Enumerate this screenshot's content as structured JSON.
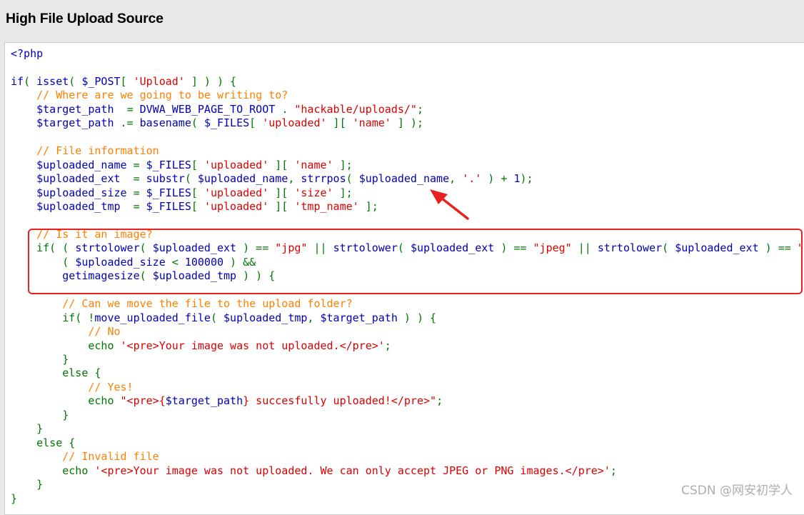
{
  "header": {
    "title": "High File Upload Source"
  },
  "colors": {
    "keyword": "#007700",
    "string": "#dd0000",
    "comment": "#ff8000",
    "default": "#0000bb",
    "annotation": "#e8231f"
  },
  "code_lines": [
    [
      [
        "def",
        "<?php"
      ]
    ],
    [],
    [
      [
        "def",
        "if"
      ],
      [
        "kw",
        "( "
      ],
      [
        "def",
        "isset"
      ],
      [
        "kw",
        "( "
      ],
      [
        "def",
        "$_POST"
      ],
      [
        "kw",
        "[ "
      ],
      [
        "str",
        "'Upload'"
      ],
      [
        "kw",
        " ] ) ) {"
      ]
    ],
    [
      [
        "cm",
        "    // Where are we going to be writing to?"
      ]
    ],
    [
      [
        "def",
        "    $target_path  "
      ],
      [
        "kw",
        "= "
      ],
      [
        "def",
        "DVWA_WEB_PAGE_TO_ROOT "
      ],
      [
        "kw",
        ". "
      ],
      [
        "str",
        "\"hackable/uploads/\""
      ],
      [
        "kw",
        ";"
      ]
    ],
    [
      [
        "def",
        "    $target_path "
      ],
      [
        "kw",
        ".= "
      ],
      [
        "def",
        "basename"
      ],
      [
        "kw",
        "( "
      ],
      [
        "def",
        "$_FILES"
      ],
      [
        "kw",
        "[ "
      ],
      [
        "str",
        "'uploaded'"
      ],
      [
        "kw",
        " ][ "
      ],
      [
        "str",
        "'name'"
      ],
      [
        "kw",
        " ] );"
      ]
    ],
    [],
    [
      [
        "cm",
        "    // File information"
      ]
    ],
    [
      [
        "def",
        "    $uploaded_name "
      ],
      [
        "kw",
        "= "
      ],
      [
        "def",
        "$_FILES"
      ],
      [
        "kw",
        "[ "
      ],
      [
        "str",
        "'uploaded'"
      ],
      [
        "kw",
        " ][ "
      ],
      [
        "str",
        "'name'"
      ],
      [
        "kw",
        " ];"
      ]
    ],
    [
      [
        "def",
        "    $uploaded_ext  "
      ],
      [
        "kw",
        "= "
      ],
      [
        "def",
        "substr"
      ],
      [
        "kw",
        "( "
      ],
      [
        "def",
        "$uploaded_name"
      ],
      [
        "kw",
        ", "
      ],
      [
        "def",
        "strrpos"
      ],
      [
        "kw",
        "( "
      ],
      [
        "def",
        "$uploaded_name"
      ],
      [
        "kw",
        ", "
      ],
      [
        "str",
        "'.'"
      ],
      [
        "kw",
        " ) + "
      ],
      [
        "def",
        "1"
      ],
      [
        "kw",
        ");"
      ]
    ],
    [
      [
        "def",
        "    $uploaded_size "
      ],
      [
        "kw",
        "= "
      ],
      [
        "def",
        "$_FILES"
      ],
      [
        "kw",
        "[ "
      ],
      [
        "str",
        "'uploaded'"
      ],
      [
        "kw",
        " ][ "
      ],
      [
        "str",
        "'size'"
      ],
      [
        "kw",
        " ];"
      ]
    ],
    [
      [
        "def",
        "    $uploaded_tmp  "
      ],
      [
        "kw",
        "= "
      ],
      [
        "def",
        "$_FILES"
      ],
      [
        "kw",
        "[ "
      ],
      [
        "str",
        "'uploaded'"
      ],
      [
        "kw",
        " ][ "
      ],
      [
        "str",
        "'tmp_name'"
      ],
      [
        "kw",
        " ];"
      ]
    ],
    [],
    [
      [
        "cm",
        "    // Is it an image?"
      ]
    ],
    [
      [
        "kw",
        "    if( ( "
      ],
      [
        "def",
        "strtolower"
      ],
      [
        "kw",
        "( "
      ],
      [
        "def",
        "$uploaded_ext"
      ],
      [
        "kw",
        " ) == "
      ],
      [
        "str",
        "\"jpg\""
      ],
      [
        "kw",
        " || "
      ],
      [
        "def",
        "strtolower"
      ],
      [
        "kw",
        "( "
      ],
      [
        "def",
        "$uploaded_ext"
      ],
      [
        "kw",
        " ) == "
      ],
      [
        "str",
        "\"jpeg\""
      ],
      [
        "kw",
        " || "
      ],
      [
        "def",
        "strtolower"
      ],
      [
        "kw",
        "( "
      ],
      [
        "def",
        "$uploaded_ext"
      ],
      [
        "kw",
        " ) == "
      ],
      [
        "str",
        "\"pn"
      ]
    ],
    [
      [
        "kw",
        "        ( "
      ],
      [
        "def",
        "$uploaded_size"
      ],
      [
        "kw",
        " < "
      ],
      [
        "def",
        "100000"
      ],
      [
        "kw",
        " ) &&"
      ]
    ],
    [
      [
        "def",
        "        getimagesize"
      ],
      [
        "kw",
        "( "
      ],
      [
        "def",
        "$uploaded_tmp"
      ],
      [
        "kw",
        " ) ) {"
      ]
    ],
    [],
    [
      [
        "cm",
        "        // Can we move the file to the upload folder?"
      ]
    ],
    [
      [
        "kw",
        "        if( !"
      ],
      [
        "def",
        "move_uploaded_file"
      ],
      [
        "kw",
        "( "
      ],
      [
        "def",
        "$uploaded_tmp"
      ],
      [
        "kw",
        ", "
      ],
      [
        "def",
        "$target_path"
      ],
      [
        "kw",
        " ) ) {"
      ]
    ],
    [
      [
        "cm",
        "            // No"
      ]
    ],
    [
      [
        "kw",
        "            echo "
      ],
      [
        "str",
        "'<pre>Your image was not uploaded.</pre>'"
      ],
      [
        "kw",
        ";"
      ]
    ],
    [
      [
        "kw",
        "        }"
      ]
    ],
    [
      [
        "kw",
        "        else {"
      ]
    ],
    [
      [
        "cm",
        "            // Yes!"
      ]
    ],
    [
      [
        "kw",
        "            echo "
      ],
      [
        "str",
        "\"<pre>{"
      ],
      [
        "def",
        "$target_path"
      ],
      [
        "str",
        "} succesfully uploaded!</pre>\""
      ],
      [
        "kw",
        ";"
      ]
    ],
    [
      [
        "kw",
        "        }"
      ]
    ],
    [
      [
        "kw",
        "    }"
      ]
    ],
    [
      [
        "kw",
        "    else {"
      ]
    ],
    [
      [
        "cm",
        "        // Invalid file"
      ]
    ],
    [
      [
        "kw",
        "        echo "
      ],
      [
        "str",
        "'<pre>Your image was not uploaded. We can only accept JPEG or PNG images.</pre>'"
      ],
      [
        "kw",
        ";"
      ]
    ],
    [
      [
        "kw",
        "    }"
      ]
    ],
    [
      [
        "kw",
        "}"
      ]
    ]
  ],
  "watermark": "CSDN @网安初学人"
}
